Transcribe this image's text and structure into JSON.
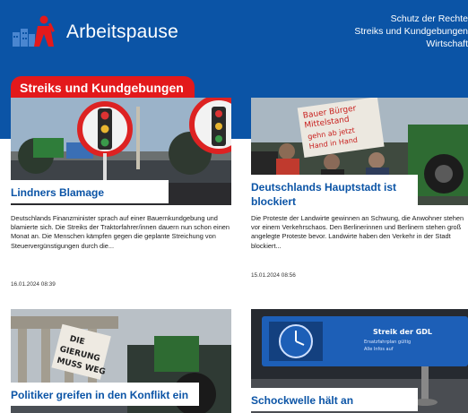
{
  "brand": {
    "name": "Arbeitspause"
  },
  "topnav": [
    {
      "label": "Schutz der Rechte"
    },
    {
      "label": "Streiks und Kundgebungen"
    },
    {
      "label": "Wirtschaft"
    }
  ],
  "section": {
    "label": "Streiks und Kundgebungen"
  },
  "articles": [
    {
      "title": "Lindners Blamage",
      "excerpt": "Deutschlands Finanzminister sprach auf einer Bauernkundgebung und blamierte sich. Die Streiks der Traktorfahrer/innen dauern nun schon einen Monat an. Die Menschen kämpfen gegen die geplante Streichung von Steuervergünstigungen durch die...",
      "date": "16.01.2024 08:39"
    },
    {
      "title": "Deutschlands Hauptstadt ist blockiert",
      "excerpt": "Die Proteste der Landwirte gewinnen an Schwung, die Anwohner stehen vor einem Verkehrschaos. Den Berlinerinnen und Berlinern stehen groß angelegte Proteste bevor. Landwirte haben den Verkehr in der Stadt blockiert...",
      "date": "15.01.2024 08:56",
      "image_text": {
        "sign_line1": "Bauer Bürger",
        "sign_line2": "Mittelstand",
        "sign_line3": "gehn ab jetzt",
        "sign_line4": "Hand in Hand"
      }
    },
    {
      "title": "Politiker greifen in den Konflikt ein",
      "image_text": {
        "sign_line1": "DIE",
        "sign_line2": "GIERUNG",
        "sign_line3": "MUSS WEG"
      }
    },
    {
      "title": "Schockwelle hält an",
      "image_text": {
        "board_line1": "Streik der GDL",
        "board_line2": "Ersatzfahrplan gültig",
        "board_line3": "Alle Infos auf"
      }
    }
  ]
}
